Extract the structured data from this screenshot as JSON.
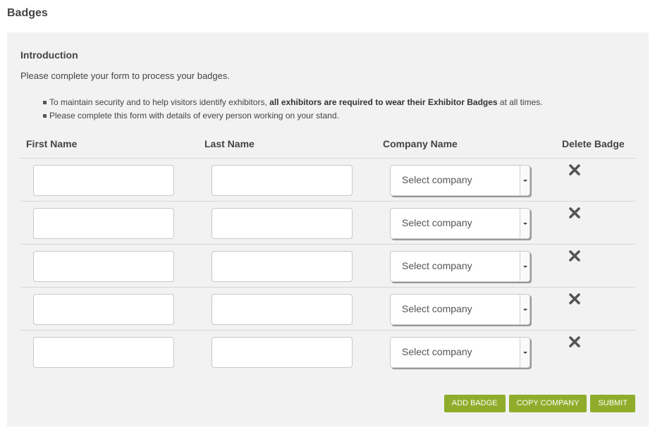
{
  "page": {
    "title": "Badges"
  },
  "intro": {
    "heading": "Introduction",
    "text": "Please complete your form to process your badges.",
    "bullets": [
      {
        "pre": "To maintain security and to help visitors identify exhibitors, ",
        "bold": "all exhibitors are required to wear their Exhibitor Badges",
        "post": " at all times."
      },
      {
        "text": "Please complete this form with details of every person working on your stand."
      }
    ]
  },
  "table": {
    "headers": {
      "first_name": "First Name",
      "last_name": "Last Name",
      "company_name": "Company Name",
      "delete": "Delete Badge"
    },
    "rows": [
      {
        "first_name": "",
        "last_name": "",
        "company": "Select company"
      },
      {
        "first_name": "",
        "last_name": "",
        "company": "Select company"
      },
      {
        "first_name": "",
        "last_name": "",
        "company": "Select company"
      },
      {
        "first_name": "",
        "last_name": "",
        "company": "Select company"
      },
      {
        "first_name": "",
        "last_name": "",
        "company": "Select company"
      }
    ]
  },
  "actions": {
    "add_badge": "ADD BADGE",
    "copy_company": "COPY COMPANY",
    "submit": "SUBMIT"
  },
  "colors": {
    "accent": "#8fad2b",
    "panel_bg": "#f2f2f2",
    "text": "#444444",
    "delete_icon": "#555555"
  },
  "icons": {
    "delete": "close-x-icon",
    "dropdown": "caret-down-icon",
    "bullet": "square-bullet-icon"
  }
}
